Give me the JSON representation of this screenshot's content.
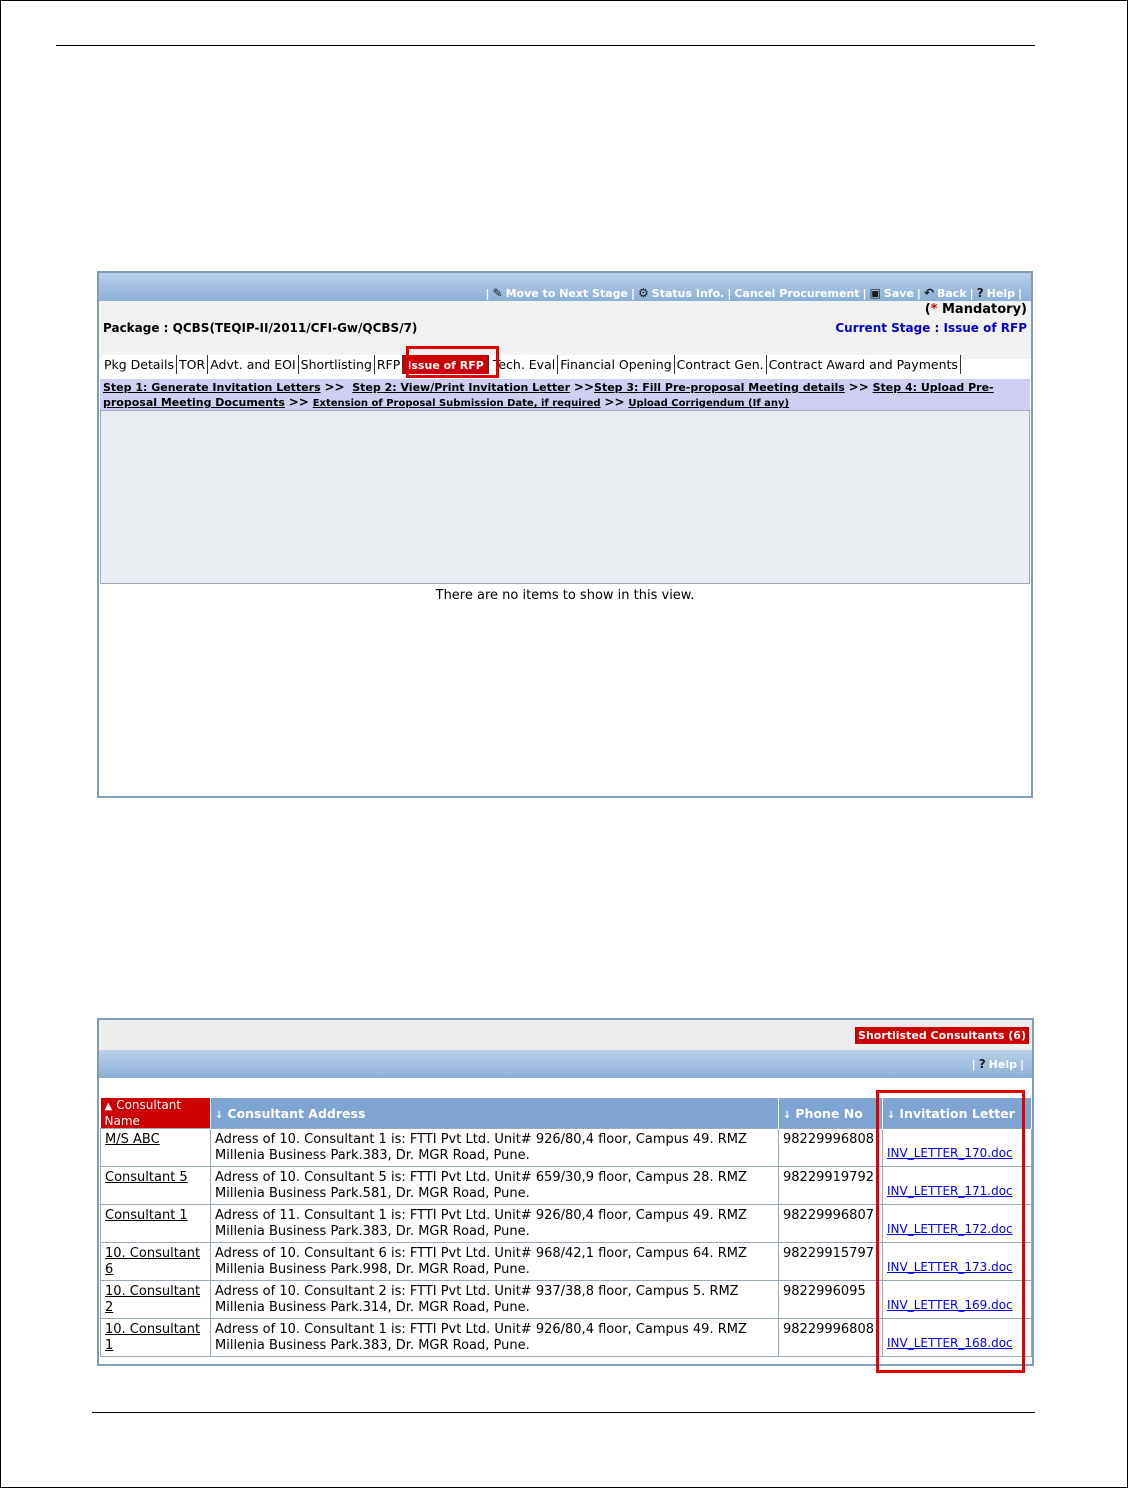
{
  "toolbar": {
    "items": [
      {
        "icon": "pencil-icon",
        "label": "Move to Next Stage"
      },
      {
        "icon": "gear-icon",
        "label": "Status Info."
      },
      {
        "icon": "",
        "label": "Cancel Procurement"
      },
      {
        "icon": "save-icon",
        "label": "Save"
      },
      {
        "icon": "back-icon",
        "label": "Back"
      },
      {
        "icon": "help-icon",
        "label": "Help"
      }
    ]
  },
  "header": {
    "mandatory_star": "*",
    "mandatory_label": "Mandatory)",
    "mandatory_open": "(",
    "package_label": "Package : QCBS(TEQIP-II/2011/CFI-Gw/QCBS/7)",
    "current_stage": "Current Stage : Issue of RFP"
  },
  "tabs": [
    {
      "label": "Pkg Details",
      "active": false
    },
    {
      "label": "TOR",
      "active": false
    },
    {
      "label": "Advt. and EOI",
      "active": false
    },
    {
      "label": "Shortlisting",
      "active": false
    },
    {
      "label": "RFP",
      "active": false
    },
    {
      "label": "Issue of RFP",
      "active": true
    },
    {
      "label": "Tech. Eval",
      "active": false
    },
    {
      "label": "Financial Opening",
      "active": false
    },
    {
      "label": "Contract Gen.",
      "active": false
    },
    {
      "label": "Contract Award and Payments",
      "active": false
    }
  ],
  "steps": {
    "step1": "Step 1: Generate Invitation Letters",
    "step2": "Step 2: View/Print Invitation Letter",
    "step3": "Step 3: Fill Pre-proposal Meeting details",
    "step4": "Step 4: Upload Pre-proposal Meeting Documents",
    "extension": "Extension of Proposal Submission Date, if required",
    "corrigendum": "Upload Corrigendum (If any)",
    "sep": ">>"
  },
  "empty_message": "There are no items to show in this view.",
  "shortlisted": {
    "badge": "Shortlisted Consultants (6)",
    "help_label": "Help",
    "columns": [
      "Consultant Name",
      "Consultant Address",
      "Phone No",
      "Invitation Letter"
    ],
    "rows": [
      {
        "name": "M/S ABC",
        "address": "Adress of 10. Consultant 1 is: FTTI Pvt Ltd. Unit# 926/80,4 floor, Campus 49. RMZ Millenia Business Park.383, Dr. MGR Road, Pune.",
        "phone": "98229996808",
        "letter": "INV_LETTER_170.doc"
      },
      {
        "name": "Consultant 5",
        "address": "Adress of 10. Consultant 5 is: FTTI Pvt Ltd. Unit# 659/30,9 floor, Campus 28. RMZ Millenia Business Park.581, Dr. MGR Road, Pune.",
        "phone": "98229919792",
        "letter": "INV_LETTER_171.doc"
      },
      {
        "name": "Consultant 1",
        "address": "Adress of 11. Consultant 1 is: FTTI Pvt Ltd. Unit# 926/80,4 floor, Campus 49. RMZ Millenia Business Park.383, Dr. MGR Road, Pune.",
        "phone": "98229996807",
        "letter": "INV_LETTER_172.doc"
      },
      {
        "name": "10. Consultant 6",
        "address": "Adress of 10. Consultant 6 is: FTTI Pvt Ltd. Unit# 968/42,1 floor, Campus 64. RMZ Millenia Business Park.998, Dr. MGR Road, Pune.",
        "phone": "98229915797",
        "letter": "INV_LETTER_173.doc"
      },
      {
        "name": "10. Consultant 2",
        "address": "Adress of 10. Consultant 2 is: FTTI Pvt Ltd. Unit# 937/38,8 floor, Campus 5. RMZ Millenia Business Park.314, Dr. MGR Road, Pune.",
        "phone": "9822996095",
        "letter": "INV_LETTER_169.doc"
      },
      {
        "name": "10. Consultant 1",
        "address": "Adress of 10. Consultant 1 is: FTTI Pvt Ltd. Unit# 926/80,4 floor, Campus 49. RMZ Millenia Business Park.383, Dr. MGR Road, Pune.",
        "phone": "98229996808",
        "letter": "INV_LETTER_168.doc"
      }
    ]
  }
}
